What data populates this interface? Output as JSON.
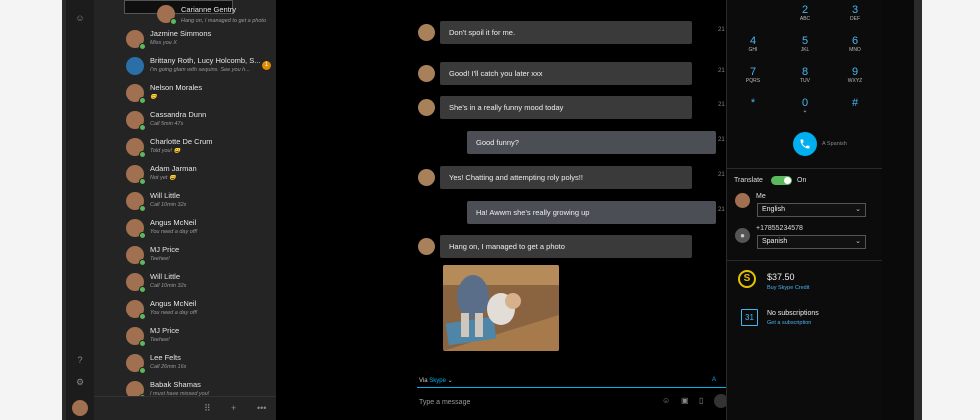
{
  "contacts": [
    {
      "name": "Carianne Gentry",
      "sub": "Hang on, I managed to get a photo",
      "selected": true
    },
    {
      "name": "Jazmine Simmons",
      "sub": "Miss you X"
    },
    {
      "name": "Brittany Roth, Lucy Holcomb, S...",
      "sub": "I'm going glam with sequins. See you h...",
      "badge": "1",
      "group": true
    },
    {
      "name": "Nelson Morales",
      "sub": "😊"
    },
    {
      "name": "Cassandra Dunn",
      "sub": "Call 5min 47s"
    },
    {
      "name": "Charlotte De Crum",
      "sub": "Told you! 😀"
    },
    {
      "name": "Adam Jarman",
      "sub": "Not yet 😀"
    },
    {
      "name": "Will Little",
      "sub": "Call 10min 32s"
    },
    {
      "name": "Angus McNeil",
      "sub": "You need a day off!"
    },
    {
      "name": "MJ Price",
      "sub": "Teehee!"
    },
    {
      "name": "Will Little",
      "sub": "Call 10min 32s"
    },
    {
      "name": "Angus McNeil",
      "sub": "You need a day off!"
    },
    {
      "name": "MJ Price",
      "sub": "Teehee!"
    },
    {
      "name": "Lee Felts",
      "sub": "Call 26min 16s"
    },
    {
      "name": "Babak Shamas",
      "sub": "I must have missed you!"
    }
  ],
  "messages": [
    {
      "text": "Don't spoil it for me.",
      "me": false
    },
    {
      "text": "Good! I'll catch you later xxx",
      "me": false
    },
    {
      "text": "She's in a really funny mood today",
      "me": false
    },
    {
      "text": "Good funny?",
      "me": true
    },
    {
      "text": "Yes! Chatting and attempting roly polys!!",
      "me": false
    },
    {
      "text": "Ha! Awwm she's really growing up",
      "me": true
    },
    {
      "text": "Hang on, I managed to get a photo",
      "me": false
    }
  ],
  "timestamps": [
    "21",
    "21",
    "21",
    "21",
    "21",
    "21"
  ],
  "composer": {
    "via_label": "Via",
    "via_service": "Skype",
    "placeholder": "Type a message"
  },
  "dialpad": [
    {
      "digit": "2",
      "letters": "ABC"
    },
    {
      "digit": "3",
      "letters": "DEF"
    },
    {
      "digit": "4",
      "letters": "GHI"
    },
    {
      "digit": "5",
      "letters": "JKL"
    },
    {
      "digit": "6",
      "letters": "MNO"
    },
    {
      "digit": "7",
      "letters": "PQRS"
    },
    {
      "digit": "8",
      "letters": "TUV"
    },
    {
      "digit": "9",
      "letters": "WXYZ"
    },
    {
      "digit": "*",
      "letters": ""
    },
    {
      "digit": "0",
      "letters": "+"
    },
    {
      "digit": "#",
      "letters": ""
    }
  ],
  "call_language": "Spanish",
  "translate": {
    "label": "Translate",
    "state": "On",
    "me_label": "Me",
    "me_language": "English",
    "other_number": "+17855234578",
    "other_language": "Spanish"
  },
  "credit": {
    "amount": "$37.50",
    "link": "Buy Skype Credit"
  },
  "subscriptions": {
    "status": "No subscriptions",
    "link": "Get a subscription",
    "calendar_day": "31"
  },
  "colors": {
    "accent": "#00aff0",
    "presence": "#5cb85c",
    "badge": "#e08a00",
    "credit": "#e5c100"
  }
}
